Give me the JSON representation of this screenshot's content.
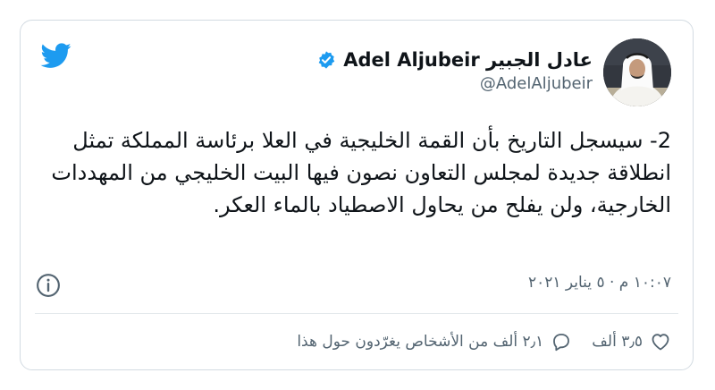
{
  "tweet": {
    "author": {
      "display_name": "Adel Aljubeir عادل الجبير",
      "handle": "@AdelAljubeir"
    },
    "text": "2- سيسجل التاريخ بأن القمة الخليجية في العلا برئاسة المملكة تمثل انطلاقة جديدة لمجلس التعاون نصون فيها البيت الخليجي من المهددات الخارجية، ولن يفلح من يحاول الاصطياد بالماء العكر.",
    "timestamp": "١٠:٠٧ م · ٥ يناير ٢٠٢١",
    "likes": "٣٫٥ ألف",
    "replies": "٢٫١ ألف من الأشخاص يغرّدون حول هذا"
  },
  "icons": {
    "brand": "twitter-bird-icon",
    "verified": "verified-badge-icon",
    "info": "info-icon",
    "like": "heart-icon",
    "reply": "speech-bubble-icon"
  },
  "colors": {
    "twitter_blue": "#1d9bf0",
    "text_primary": "#0f1419",
    "text_secondary": "#536471",
    "border": "#d3dbe2"
  }
}
